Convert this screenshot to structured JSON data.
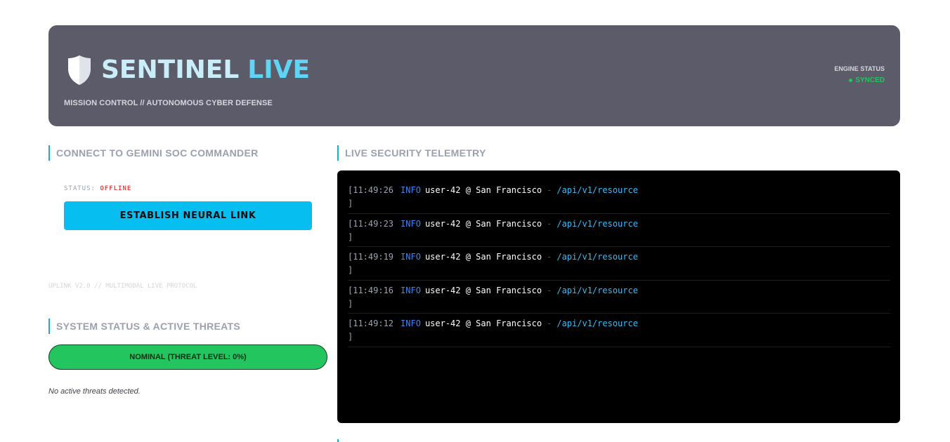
{
  "header": {
    "title_part1": "SENTINEL",
    "title_part2": "LIVE",
    "tagline": "MISSION CONTROL // AUTONOMOUS CYBER DEFENSE",
    "engine_label": "ENGINE STATUS",
    "engine_value": "SYNCED"
  },
  "connect": {
    "title": "CONNECT TO GEMINI SOC COMMANDER",
    "status_label": "STATUS:",
    "status_value": "OFFLINE",
    "button_label": "ESTABLISH NEURAL LINK",
    "footer": "UPLINK V2.0 // MULTIMODAL LIVE PROTOCOL"
  },
  "system": {
    "title": "SYSTEM STATUS & ACTIVE THREATS",
    "nominal": "NOMINAL (THREAT LEVEL: 0%)",
    "threats_text": "No active threats detected."
  },
  "telemetry": {
    "title": "LIVE SECURITY TELEMETRY",
    "logs": [
      {
        "ts": "[11:49:26",
        "level": "INFO",
        "who": "user-42 @ San Francisco",
        "sep": "-",
        "path": "/api/v1/resource",
        "close": "]"
      },
      {
        "ts": "[11:49:23",
        "level": "INFO",
        "who": "user-42 @ San Francisco",
        "sep": "-",
        "path": "/api/v1/resource",
        "close": "]"
      },
      {
        "ts": "[11:49:19",
        "level": "INFO",
        "who": "user-42 @ San Francisco",
        "sep": "-",
        "path": "/api/v1/resource",
        "close": "]"
      },
      {
        "ts": "[11:49:16",
        "level": "INFO",
        "who": "user-42 @ San Francisco",
        "sep": "-",
        "path": "/api/v1/resource",
        "close": "]"
      },
      {
        "ts": "[11:49:12",
        "level": "INFO",
        "who": "user-42 @ San Francisco",
        "sep": "-",
        "path": "/api/v1/resource",
        "close": "]"
      }
    ]
  },
  "colors": {
    "accent": "#06b6d4",
    "button": "#06bff0",
    "ok": "#22c55e",
    "danger": "#ef4444"
  }
}
